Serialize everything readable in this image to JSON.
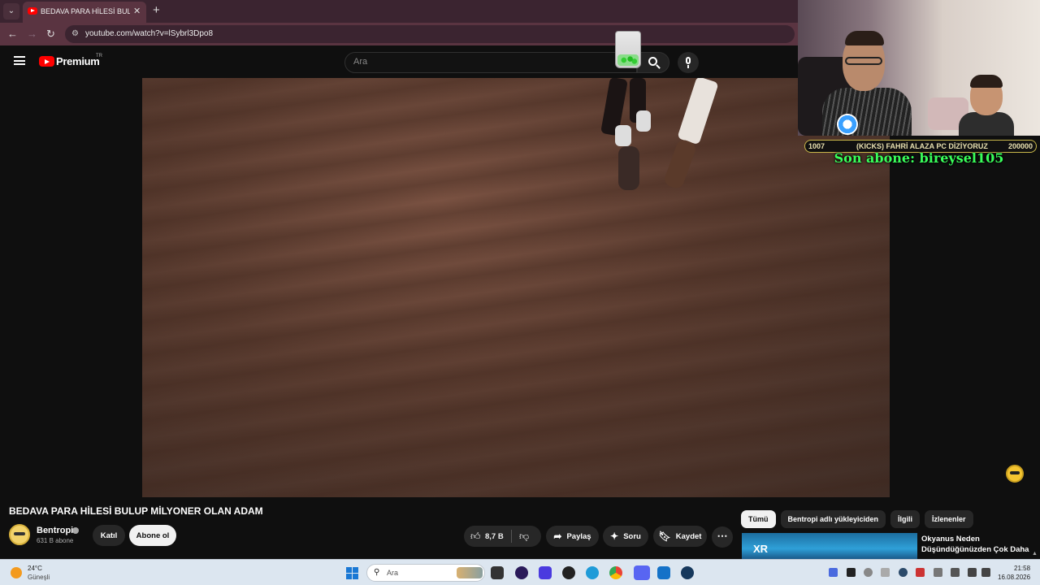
{
  "browser": {
    "tab_title": "BEDAVA PARA HİLESİ BULUP MİLYONER OLAN ADAM",
    "tab_close": "✕",
    "new_tab": "+",
    "url": "youtube.com/watch?v=lSybrl3Dpo8"
  },
  "youtube": {
    "logo_text": "Premium",
    "logo_region": "TR",
    "search_placeholder": "Ara"
  },
  "video": {
    "title": "BEDAVA PARA HİLESİ BULUP MİLYONER OLAN ADAM",
    "channel": "Bentropi",
    "subscribers": "631 B abone",
    "join_label": "Katıl",
    "subscribe_label": "Abone ol",
    "likes": "8,7 B",
    "share_label": "Paylaş",
    "ask_label": "Soru",
    "save_label": "Kaydet",
    "more_label": "⋯"
  },
  "recommendations": {
    "chips": [
      "Tümü",
      "Bentropi adlı yükleyiciden",
      "İlgili",
      "İzlenenler"
    ],
    "items": [
      {
        "title": "Okyanus Neden Düşündüğünüzden Çok Daha",
        "thumb_text": "XR"
      }
    ]
  },
  "stream_overlay": {
    "goal_current": "1007",
    "goal_title": "(KICKS) FAHRİ ALAZA PC DİZİYORUZ",
    "goal_target": "200000",
    "last_sub": "Son abone: bireysel105"
  },
  "taskbar": {
    "weather_temp": "24°C",
    "weather_desc": "Güneşli",
    "search_text": "Ara",
    "time": "21:58",
    "date": "16.08.2026",
    "apps": [
      "start",
      "search",
      "task-view",
      "obs",
      "crypto-app",
      "brawl-app",
      "edge",
      "chrome",
      "discord",
      "video-app",
      "steam"
    ]
  },
  "colors": {
    "youtube_red": "#ff0000",
    "browser_accent": "#5a3441",
    "overlay_green": "#39ff5a"
  }
}
